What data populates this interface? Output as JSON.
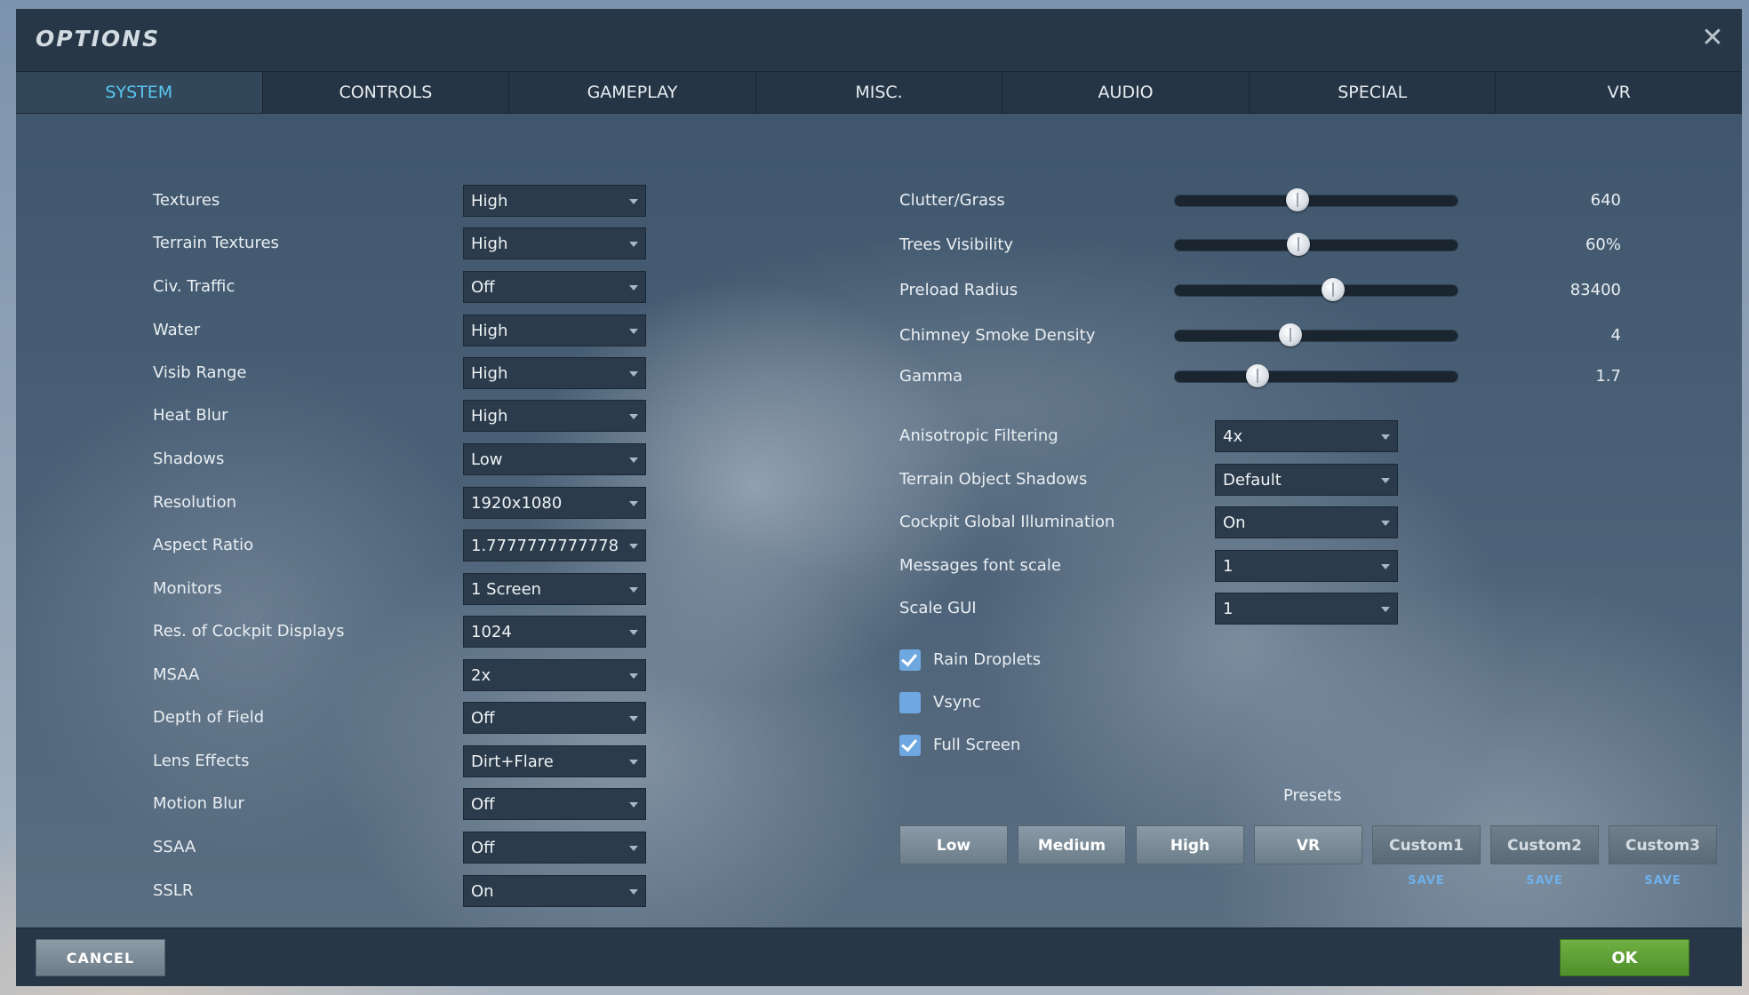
{
  "window": {
    "title": "OPTIONS",
    "close_icon": "close-icon"
  },
  "tabs": [
    "SYSTEM",
    "CONTROLS",
    "GAMEPLAY",
    "MISC.",
    "AUDIO",
    "SPECIAL",
    "VR"
  ],
  "active_tab": "SYSTEM",
  "left_settings": [
    {
      "label": "Textures",
      "value": "High"
    },
    {
      "label": "Terrain Textures",
      "value": "High"
    },
    {
      "label": "Civ. Traffic",
      "value": "Off"
    },
    {
      "label": "Water",
      "value": "High"
    },
    {
      "label": "Visib Range",
      "value": "High"
    },
    {
      "label": "Heat Blur",
      "value": "High"
    },
    {
      "label": "Shadows",
      "value": "Low"
    },
    {
      "label": "Resolution",
      "value": "1920x1080"
    },
    {
      "label": "Aspect Ratio",
      "value": "1.7777777777778"
    },
    {
      "label": "Monitors",
      "value": "1 Screen"
    },
    {
      "label": "Res. of Cockpit Displays",
      "value": "1024"
    },
    {
      "label": "MSAA",
      "value": "2x"
    },
    {
      "label": "Depth of Field",
      "value": "Off"
    },
    {
      "label": "Lens Effects",
      "value": "Dirt+Flare"
    },
    {
      "label": "Motion Blur",
      "value": "Off"
    },
    {
      "label": "SSAA",
      "value": "Off"
    },
    {
      "label": "SSLR",
      "value": "On"
    }
  ],
  "sliders": [
    {
      "label": "Clutter/Grass",
      "value": "640",
      "fraction": 0.43
    },
    {
      "label": "Trees Visibility",
      "value": "60%",
      "fraction": 0.435
    },
    {
      "label": "Preload Radius",
      "value": "83400",
      "fraction": 0.555
    },
    {
      "label": "Chimney Smoke Density",
      "value": "4",
      "fraction": 0.405
    },
    {
      "label": "Gamma",
      "value": "1.7",
      "fraction": 0.29
    }
  ],
  "right_dropdowns": [
    {
      "label": "Anisotropic Filtering",
      "value": "4x"
    },
    {
      "label": "Terrain Object Shadows",
      "value": "Default"
    },
    {
      "label": "Cockpit Global Illumination",
      "value": "On"
    },
    {
      "label": "Messages font scale",
      "value": "1"
    },
    {
      "label": "Scale GUI",
      "value": "1"
    }
  ],
  "checkboxes": [
    {
      "label": "Rain Droplets",
      "checked": true
    },
    {
      "label": "Vsync",
      "checked": false
    },
    {
      "label": "Full Screen",
      "checked": true
    }
  ],
  "presets": {
    "title": "Presets",
    "buttons": [
      "Low",
      "Medium",
      "High",
      "VR",
      "Custom1",
      "Custom2",
      "Custom3"
    ],
    "save_label": "SAVE"
  },
  "footer": {
    "cancel": "CANCEL",
    "ok": "OK"
  }
}
